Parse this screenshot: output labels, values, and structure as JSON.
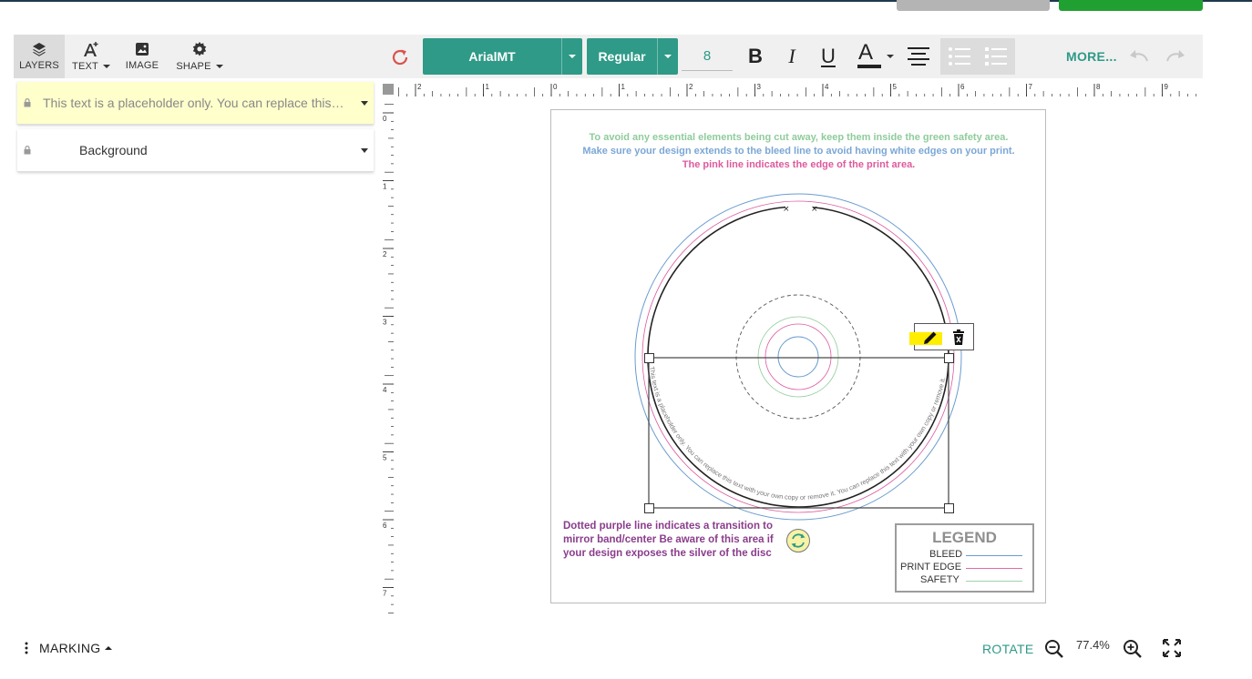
{
  "toolbar": {
    "tools": [
      {
        "label": "LAYERS",
        "icon": "layers-icon",
        "active": true
      },
      {
        "label": "TEXT",
        "icon": "text-icon",
        "has_dropdown": true
      },
      {
        "label": "IMAGE",
        "icon": "image-icon"
      },
      {
        "label": "SHAPE",
        "icon": "shape-icon",
        "has_dropdown": true
      }
    ],
    "font_family": "ArialMT",
    "font_style": "Regular",
    "font_size": "8",
    "bold_label": "B",
    "italic_label": "I",
    "underline_label": "U",
    "color_label": "A",
    "more_label": "MORE...",
    "accent_color": "#2e9a87"
  },
  "layers": [
    {
      "name": "This text is a placeholder only. You can replace this text with your own copy or remove it.",
      "locked": true,
      "selected": true,
      "highlight": "#ffffcc"
    },
    {
      "name": "Background",
      "locked": true,
      "selected": false
    }
  ],
  "ruler": {
    "horizontal_ticks": [
      "2",
      "1",
      "0",
      "1",
      "2",
      "3",
      "4",
      "5",
      "6",
      "7",
      "8",
      "9"
    ],
    "vertical_ticks": [
      "0",
      "1",
      "2",
      "3",
      "4",
      "5",
      "6",
      "7"
    ]
  },
  "canvas": {
    "instructions": {
      "safety": "To avoid any essential elements being cut away, keep them inside the green safety area.",
      "bleed": "Make sure your design extends to the bleed line to avoid having white edges on your print.",
      "print_edge": "The pink line indicates the edge of the print area."
    },
    "mirror_note": "Dotted purple line indicates a transition to mirror band/center Be aware of this area if your design exposes the silver of the disc",
    "curved_text": "This text is a placeholder only. You can replace this text with your own copy or remove it. You can replace this text with your own copy or remove it.",
    "legend": {
      "title": "LEGEND",
      "items": [
        {
          "label": "BLEED",
          "color": "#7ba7d6"
        },
        {
          "label": "PRINT EDGE",
          "color": "#e06aa8"
        },
        {
          "label": "SAFETY",
          "color": "#9fd3a8"
        }
      ]
    },
    "colors": {
      "safety": "#8fcc9b",
      "bleed": "#6a9cd0",
      "print_edge": "#dd5a9e",
      "mirror": "#8a3d8c"
    }
  },
  "bottom_bar": {
    "marking_label": "MARKING",
    "rotate_label": "ROTATE",
    "zoom": "77.4%"
  }
}
